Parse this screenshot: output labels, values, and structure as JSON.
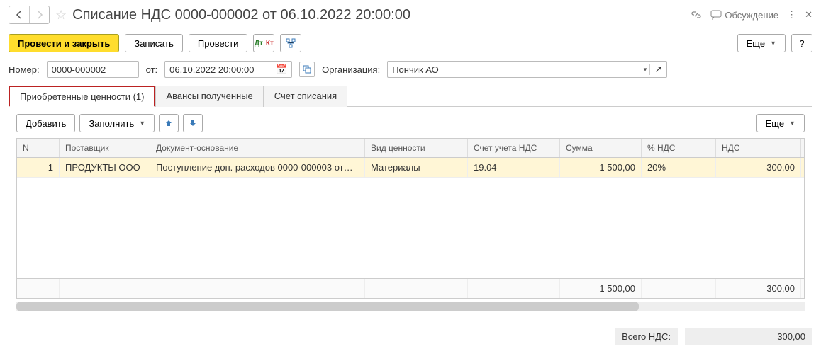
{
  "title": "Списание НДС 0000-000002 от 06.10.2022 20:00:00",
  "discuss": "Обсуждение",
  "toolbar": {
    "post_close": "Провести и закрыть",
    "save": "Записать",
    "post": "Провести",
    "more": "Еще",
    "help": "?"
  },
  "fields": {
    "number_label": "Номер:",
    "number_value": "0000-000002",
    "from_label": "от:",
    "date_value": "06.10.2022 20:00:00",
    "org_label": "Организация:",
    "org_value": "Пончик АО"
  },
  "tabs": {
    "t1": "Приобретенные ценности (1)",
    "t2": "Авансы полученные",
    "t3": "Счет списания"
  },
  "panel": {
    "add": "Добавить",
    "fill": "Заполнить",
    "more": "Еще"
  },
  "columns": {
    "n": "N",
    "supplier": "Поставщик",
    "doc": "Документ-основание",
    "type": "Вид ценности",
    "acc": "Счет учета НДС",
    "sum": "Сумма",
    "pct": "% НДС",
    "vat": "НДС"
  },
  "row": {
    "n": "1",
    "supplier": "ПРОДУКТЫ ООО",
    "doc": "Поступление доп. расходов 0000-000003 от…",
    "type": "Материалы",
    "acc": "19.04",
    "sum": "1 500,00",
    "pct": "20%",
    "vat": "300,00"
  },
  "totals": {
    "sum": "1 500,00",
    "vat": "300,00"
  },
  "footer": {
    "label": "Всего НДС:",
    "value": "300,00"
  }
}
